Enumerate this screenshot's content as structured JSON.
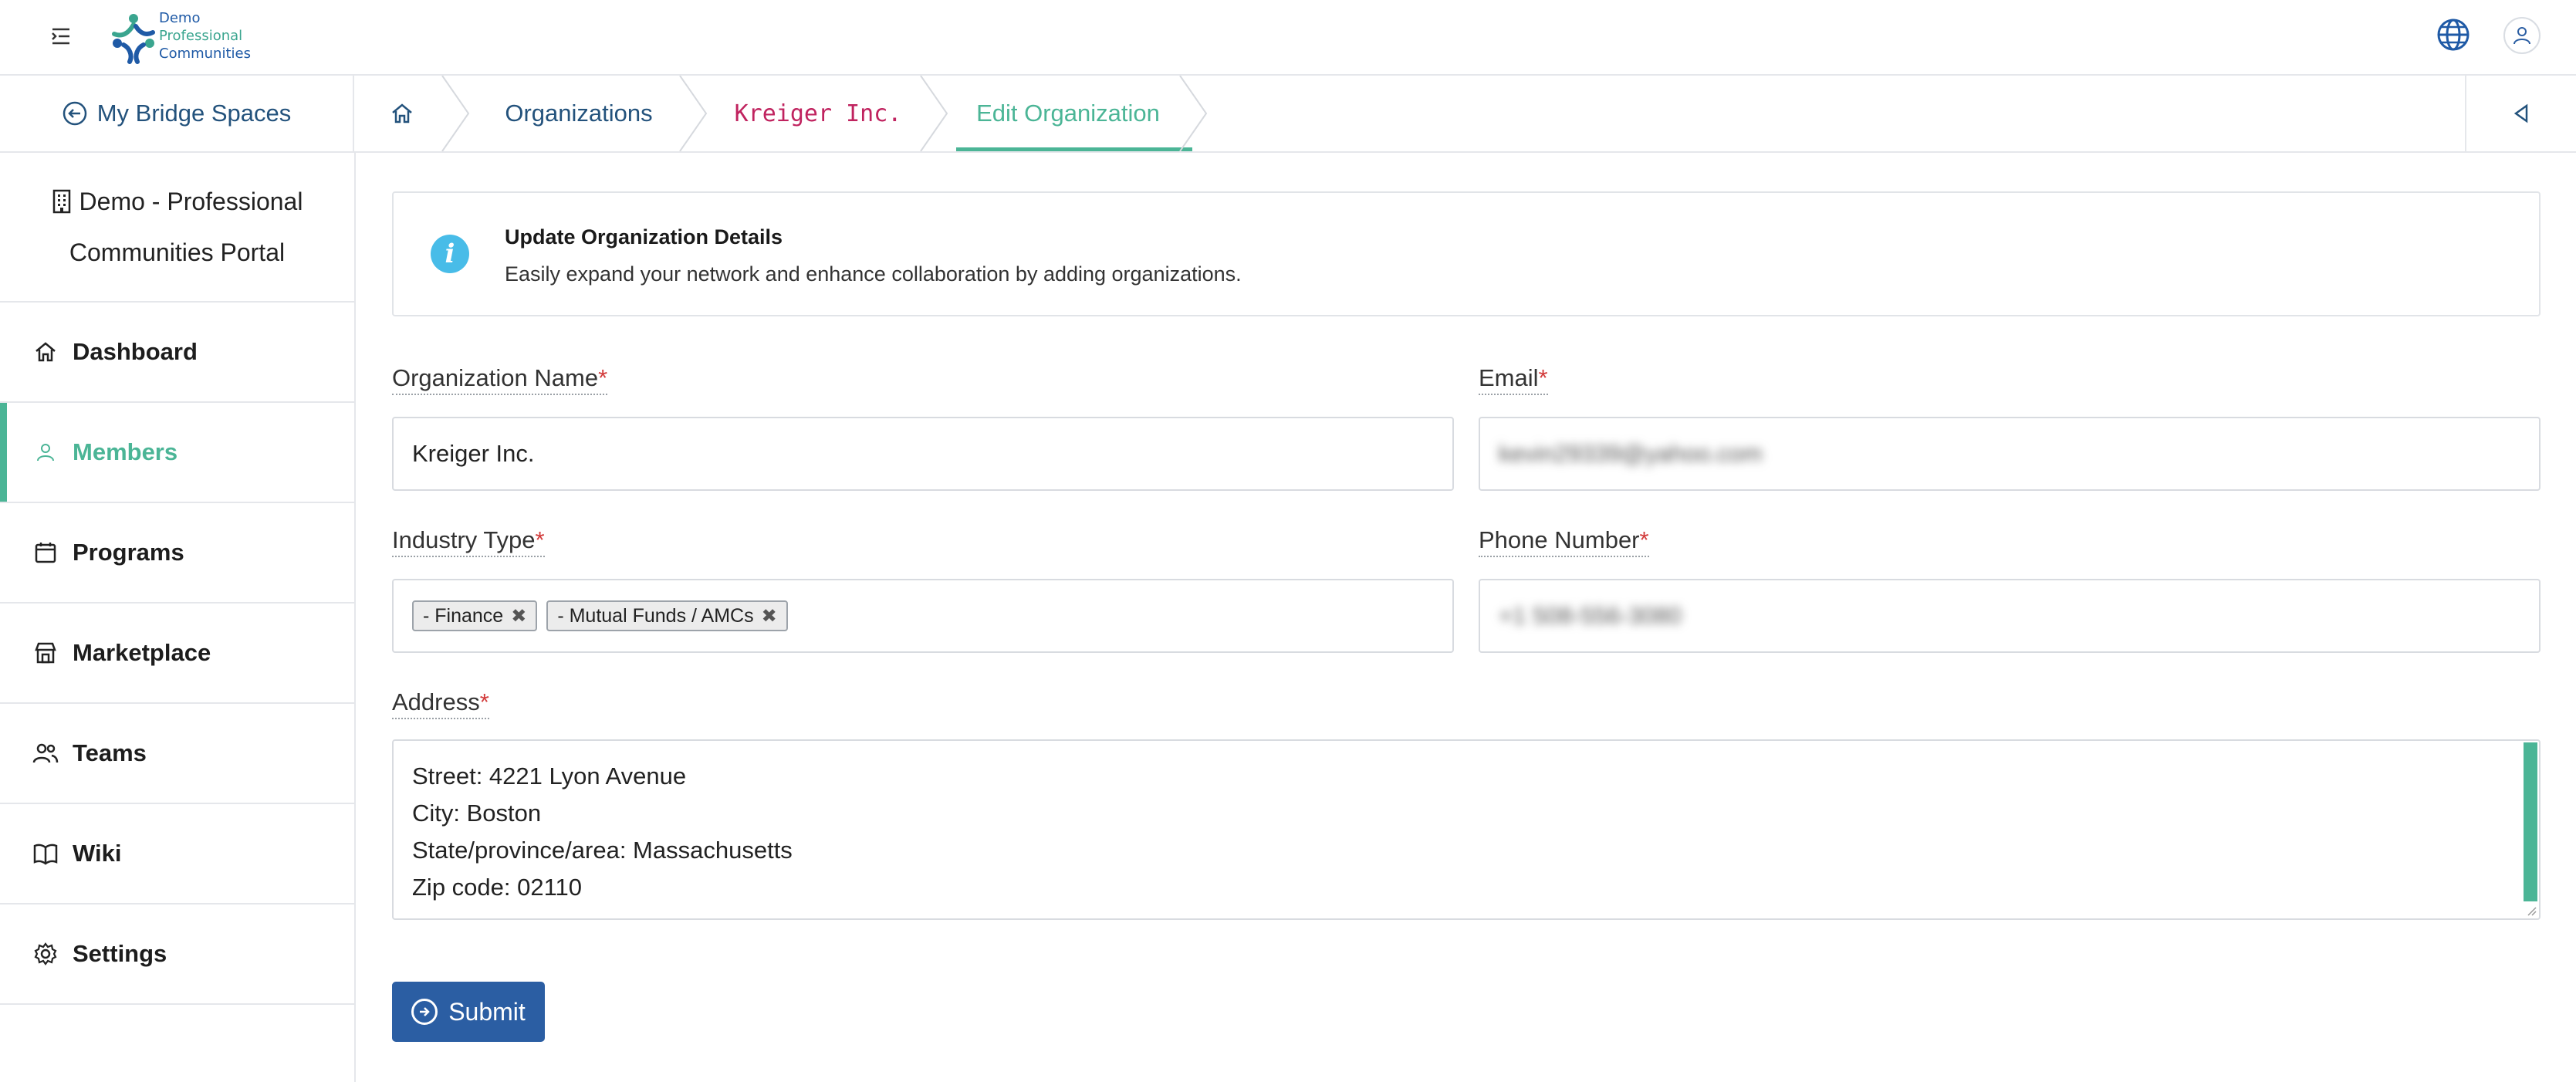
{
  "header": {
    "logo_lines": [
      "Demo",
      "Professional",
      "Communities"
    ]
  },
  "subheader": {
    "back_label": "My Bridge Spaces",
    "breadcrumbs": [
      "Organizations",
      "Kreiger Inc.",
      "Edit Organization"
    ]
  },
  "sidebar": {
    "portal_name_line1": "Demo - Professional",
    "portal_name_line2": "Communities Portal",
    "items": [
      {
        "label": "Dashboard",
        "icon": "home-icon",
        "active": false
      },
      {
        "label": "Members",
        "icon": "user-icon",
        "active": true
      },
      {
        "label": "Programs",
        "icon": "calendar-icon",
        "active": false
      },
      {
        "label": "Marketplace",
        "icon": "store-icon",
        "active": false
      },
      {
        "label": "Teams",
        "icon": "users-icon",
        "active": false
      },
      {
        "label": "Wiki",
        "icon": "book-icon",
        "active": false
      },
      {
        "label": "Settings",
        "icon": "gear-icon",
        "active": false
      }
    ]
  },
  "info": {
    "title": "Update Organization Details",
    "description": "Easily expand your network and enhance collaboration by adding organizations."
  },
  "form": {
    "org_name_label": "Organization Name",
    "org_name_value": "Kreiger Inc.",
    "email_label": "Email",
    "email_value": "kevin29339@yahoo.com",
    "industry_label": "Industry Type",
    "industry_tags": [
      "- Finance",
      "- Mutual Funds / AMCs"
    ],
    "phone_label": "Phone Number",
    "phone_value": "+1 508-556-3080",
    "address_label": "Address",
    "address_lines": [
      "Street:  4221 Lyon Avenue",
      "City:  Boston",
      "State/province/area:   Massachusetts",
      "Zip code:  02110"
    ],
    "required_mark": "*",
    "submit_label": "Submit"
  },
  "colors": {
    "accent": "#4bb596",
    "primary": "#2b5ea3",
    "link": "#23527c",
    "required": "#d23b3b",
    "info": "#48bce8"
  }
}
